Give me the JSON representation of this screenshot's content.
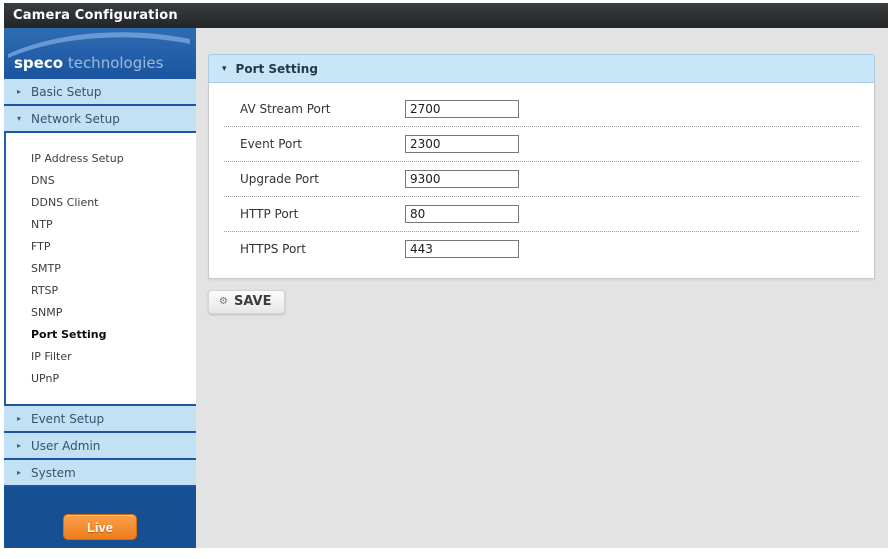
{
  "title_bar": {
    "title": "Camera Configuration"
  },
  "icons": {
    "collapsed_triangle": "▸",
    "expanded_triangle": "▾",
    "gear": "⚙"
  },
  "colors": {
    "accent_blue": "#1d55a4",
    "sidebar_header_blue": "#c2e1f4",
    "panel_header_blue": "#c9e5f8",
    "footer_navy": "#164f92",
    "live_orange": "#ef7d1a",
    "content_gray": "#e3e3e3",
    "titlebar_dark": "#232628"
  },
  "sidebar": {
    "logo": {
      "brand_bold": "speco",
      "brand_light": "technologies"
    },
    "sections": [
      {
        "label": "Basic Setup",
        "expanded": false
      },
      {
        "label": "Network Setup",
        "expanded": true,
        "items": [
          {
            "label": "IP Address Setup",
            "active": false
          },
          {
            "label": "DNS",
            "active": false
          },
          {
            "label": "DDNS Client",
            "active": false
          },
          {
            "label": "NTP",
            "active": false
          },
          {
            "label": "FTP",
            "active": false
          },
          {
            "label": "SMTP",
            "active": false
          },
          {
            "label": "RTSP",
            "active": false
          },
          {
            "label": "SNMP",
            "active": false
          },
          {
            "label": "Port Setting",
            "active": true
          },
          {
            "label": "IP Filter",
            "active": false
          },
          {
            "label": "UPnP",
            "active": false
          }
        ]
      },
      {
        "label": "Event Setup",
        "expanded": false
      },
      {
        "label": "User Admin",
        "expanded": false
      },
      {
        "label": "System",
        "expanded": false
      }
    ],
    "live_button": "Live"
  },
  "main": {
    "panel_title": "Port Setting",
    "fields": [
      {
        "label": "AV Stream Port",
        "value": "2700"
      },
      {
        "label": "Event Port",
        "value": "2300"
      },
      {
        "label": "Upgrade Port",
        "value": "9300"
      },
      {
        "label": "HTTP Port",
        "value": "80"
      },
      {
        "label": "HTTPS Port",
        "value": "443"
      }
    ],
    "save_button": "SAVE"
  }
}
